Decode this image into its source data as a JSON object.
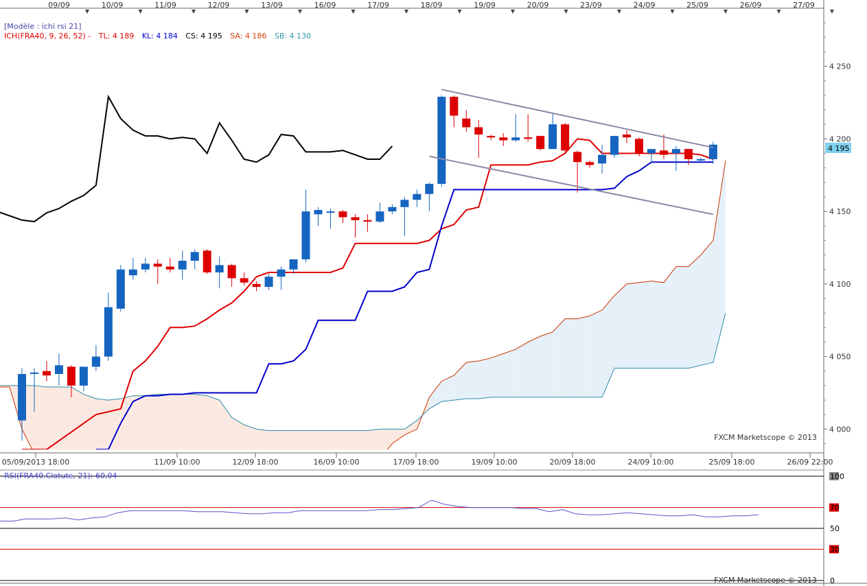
{
  "chart_data": {
    "type": "candlestick",
    "instrument": "FRA40",
    "model_label": "[Modèle : ichi rsi 21]",
    "top_dates": [
      "09/09",
      "10/09",
      "11/09",
      "12/09",
      "13/09",
      "16/09",
      "17/09",
      "18/09",
      "19/09",
      "20/09",
      "23/09",
      "24/09",
      "25/09",
      "26/09",
      "27/09"
    ],
    "bottom_dates": [
      "05/09/2013 18:00",
      "11/09 10:00",
      "12/09 18:00",
      "16/09 10:00",
      "17/09 18:00",
      "19/09 10:00",
      "20/09 18:00",
      "24/09 10:00",
      "25/09 18:00",
      "26/09 22:00"
    ],
    "price_ticks": [
      "4 250",
      "4 200",
      "4 150",
      "4 100",
      "4 050",
      "4 000"
    ],
    "price_ylim": [
      3986,
      4290
    ],
    "current_price_label": "4 195",
    "watermark": "FXCM Marketscope © 2013",
    "ichimoku": {
      "label": "ICH(FRA40, 9, 26, 52) -",
      "items": [
        {
          "text": "TL: 4 189",
          "color": "#e00000"
        },
        {
          "text": "KL: 4 184",
          "color": "#0000cc"
        },
        {
          "text": "CS: 4 195",
          "color": "#000000"
        },
        {
          "text": "SA: 4 186",
          "color": "#d04010"
        },
        {
          "text": "SB: 4 130",
          "color": "#3399aa"
        }
      ]
    },
    "candles": [
      {
        "o": 4006,
        "h": 4042,
        "l": 3992,
        "c": 4038
      },
      {
        "o": 4038,
        "h": 4042,
        "l": 4012,
        "c": 4039
      },
      {
        "o": 4040,
        "h": 4047,
        "l": 4033,
        "c": 4037
      },
      {
        "o": 4038,
        "h": 4052,
        "l": 4030,
        "c": 4044
      },
      {
        "o": 4043,
        "h": 4044,
        "l": 4022,
        "c": 4030
      },
      {
        "o": 4030,
        "h": 4043,
        "l": 4026,
        "c": 4043
      },
      {
        "o": 4043,
        "h": 4058,
        "l": 4040,
        "c": 4050
      },
      {
        "o": 4050,
        "h": 4094,
        "l": 4047,
        "c": 4084
      },
      {
        "o": 4083,
        "h": 4113,
        "l": 4081,
        "c": 4110
      },
      {
        "o": 4106,
        "h": 4118,
        "l": 4103,
        "c": 4110
      },
      {
        "o": 4110,
        "h": 4118,
        "l": 4108,
        "c": 4114
      },
      {
        "o": 4114,
        "h": 4117,
        "l": 4100,
        "c": 4112
      },
      {
        "o": 4112,
        "h": 4118,
        "l": 4108,
        "c": 4110
      },
      {
        "o": 4110,
        "h": 4123,
        "l": 4103,
        "c": 4116
      },
      {
        "o": 4116,
        "h": 4124,
        "l": 4110,
        "c": 4122
      },
      {
        "o": 4123,
        "h": 4124,
        "l": 4107,
        "c": 4108
      },
      {
        "o": 4108,
        "h": 4119,
        "l": 4097,
        "c": 4113
      },
      {
        "o": 4113,
        "h": 4114,
        "l": 4098,
        "c": 4104
      },
      {
        "o": 4104,
        "h": 4108,
        "l": 4099,
        "c": 4101
      },
      {
        "o": 4100,
        "h": 4102,
        "l": 4095,
        "c": 4098
      },
      {
        "o": 4098,
        "h": 4107,
        "l": 4096,
        "c": 4105
      },
      {
        "o": 4105,
        "h": 4112,
        "l": 4096,
        "c": 4110
      },
      {
        "o": 4110,
        "h": 4117,
        "l": 4107,
        "c": 4117
      },
      {
        "o": 4117,
        "h": 4165,
        "l": 4115,
        "c": 4150
      },
      {
        "o": 4148,
        "h": 4153,
        "l": 4140,
        "c": 4151
      },
      {
        "o": 4150,
        "h": 4152,
        "l": 4138,
        "c": 4150
      },
      {
        "o": 4150,
        "h": 4151,
        "l": 4142,
        "c": 4146
      },
      {
        "o": 4146,
        "h": 4148,
        "l": 4132,
        "c": 4144
      },
      {
        "o": 4144,
        "h": 4148,
        "l": 4136,
        "c": 4143
      },
      {
        "o": 4143,
        "h": 4156,
        "l": 4142,
        "c": 4150
      },
      {
        "o": 4150,
        "h": 4155,
        "l": 4148,
        "c": 4153
      },
      {
        "o": 4153,
        "h": 4160,
        "l": 4133,
        "c": 4158
      },
      {
        "o": 4158,
        "h": 4165,
        "l": 4153,
        "c": 4162
      },
      {
        "o": 4162,
        "h": 4170,
        "l": 4150,
        "c": 4169
      },
      {
        "o": 4169,
        "h": 4230,
        "l": 4167,
        "c": 4229
      },
      {
        "o": 4229,
        "h": 4230,
        "l": 4208,
        "c": 4216
      },
      {
        "o": 4214,
        "h": 4220,
        "l": 4205,
        "c": 4208
      },
      {
        "o": 4208,
        "h": 4213,
        "l": 4187,
        "c": 4203
      },
      {
        "o": 4202,
        "h": 4203,
        "l": 4199,
        "c": 4201
      },
      {
        "o": 4201,
        "h": 4204,
        "l": 4195,
        "c": 4199
      },
      {
        "o": 4199,
        "h": 4217,
        "l": 4198,
        "c": 4201
      },
      {
        "o": 4201,
        "h": 4217,
        "l": 4198,
        "c": 4200
      },
      {
        "o": 4202,
        "h": 4202,
        "l": 4192,
        "c": 4193
      },
      {
        "o": 4193,
        "h": 4218,
        "l": 4193,
        "c": 4210
      },
      {
        "o": 4210,
        "h": 4211,
        "l": 4190,
        "c": 4192
      },
      {
        "o": 4191,
        "h": 4192,
        "l": 4163,
        "c": 4184
      },
      {
        "o": 4184,
        "h": 4185,
        "l": 4180,
        "c": 4182
      },
      {
        "o": 4183,
        "h": 4196,
        "l": 4176,
        "c": 4189
      },
      {
        "o": 4189,
        "h": 4202,
        "l": 4187,
        "c": 4202
      },
      {
        "o": 4203,
        "h": 4206,
        "l": 4197,
        "c": 4201
      },
      {
        "o": 4200,
        "h": 4201,
        "l": 4188,
        "c": 4190
      },
      {
        "o": 4190,
        "h": 4193,
        "l": 4183,
        "c": 4193
      },
      {
        "o": 4192,
        "h": 4203,
        "l": 4186,
        "c": 4189
      },
      {
        "o": 4190,
        "h": 4195,
        "l": 4178,
        "c": 4193
      },
      {
        "o": 4193,
        "h": 4193,
        "l": 4182,
        "c": 4186
      },
      {
        "o": 4186,
        "h": 4187,
        "l": 4184,
        "c": 4186
      },
      {
        "o": 4186,
        "h": 4198,
        "l": 4183,
        "c": 4196
      }
    ],
    "chikou": [
      4150,
      4147,
      4144,
      4143,
      4149,
      4152,
      4157,
      4161,
      4168,
      4229,
      4214,
      4206,
      4202,
      4202,
      4200,
      4201,
      4200,
      4190,
      4211,
      4199,
      4186,
      4184,
      4189,
      4203,
      4202,
      4191,
      4191,
      4191,
      4192,
      4189,
      4186,
      4186,
      4195
    ],
    "tenkan_x": [
      0,
      2,
      6,
      7,
      8,
      9,
      10,
      11,
      12,
      13,
      14,
      15,
      16,
      17,
      18,
      19,
      20,
      21,
      22,
      23,
      24,
      25,
      26,
      27,
      28,
      29,
      30,
      31,
      32,
      33,
      34,
      35,
      36,
      37,
      38,
      39,
      40,
      41,
      42,
      43,
      44,
      45,
      46,
      47,
      48,
      49,
      50,
      51,
      52,
      53,
      54,
      55,
      56
    ],
    "tenkan": [
      3960,
      3985,
      4010,
      4012,
      4014,
      4040,
      4047,
      4057,
      4070,
      4070,
      4071,
      4076,
      4082,
      4087,
      4095,
      4105,
      4108,
      4108,
      4108,
      4108,
      4108,
      4108,
      4111,
      4128,
      4128,
      4128,
      4128,
      4128,
      4128,
      4130,
      4138,
      4141,
      4151,
      4153,
      4182,
      4182,
      4182,
      4182,
      4184,
      4185,
      4190,
      4200,
      4199,
      4190,
      4190,
      4190,
      4190,
      4190,
      4190,
      4190,
      4190,
      4189,
      4186,
      4185,
      4188,
      4190,
      4189
    ],
    "kijun_x": [
      6,
      7,
      8,
      9,
      10,
      11,
      12,
      13,
      14,
      15,
      16,
      17,
      18,
      19,
      20,
      21,
      22,
      23,
      24,
      25,
      26,
      27,
      28,
      29,
      30,
      31,
      32,
      33,
      34,
      35,
      36,
      37,
      38,
      39,
      40,
      41,
      42,
      43,
      44,
      45,
      46,
      47,
      48,
      49,
      50,
      51,
      52,
      53,
      54,
      55,
      56
    ],
    "kijun": [
      3966,
      3985,
      4004,
      4019,
      4023,
      4023,
      4024,
      4024,
      4025,
      4025,
      4025,
      4025,
      4025,
      4025,
      4045,
      4045,
      4047,
      4055,
      4075,
      4075,
      4075,
      4075,
      4095,
      4095,
      4095,
      4098,
      4108,
      4110,
      4140,
      4165,
      4165,
      4165,
      4165,
      4165,
      4165,
      4165,
      4165,
      4165,
      4165,
      4165,
      4165,
      4165,
      4166,
      4174,
      4178,
      4184,
      4184,
      4184,
      4184,
      4184,
      4184
    ],
    "senkou_a_x": [
      0,
      1,
      2,
      3,
      4,
      5,
      6,
      7,
      8,
      9,
      10,
      11,
      12,
      13,
      14,
      15,
      16,
      17,
      18,
      19,
      20,
      21,
      22,
      23,
      24,
      25,
      26,
      27,
      28,
      29,
      30,
      31,
      32,
      33,
      34,
      35,
      36,
      37,
      38,
      39,
      40,
      41,
      42,
      43,
      44,
      45,
      46,
      47,
      48,
      49,
      50,
      51,
      52,
      53,
      54,
      55,
      56,
      57
    ],
    "senkou_a": [
      4029,
      4029,
      4000,
      3983,
      3980,
      3980,
      3980,
      3980,
      3980,
      3980,
      3980,
      3980,
      3980,
      3980,
      3980,
      3980,
      3980,
      3980,
      3980,
      3980,
      3980,
      3980,
      3980,
      3980,
      3980,
      3980,
      3980,
      3980,
      3980,
      3980,
      3980,
      3980,
      3990,
      3996,
      4000,
      4022,
      4033,
      4037,
      4046,
      4047,
      4049,
      4052,
      4055,
      4060,
      4064,
      4067,
      4076,
      4076,
      4078,
      4082,
      4092,
      4100,
      4101,
      4102,
      4101,
      4112,
      4112,
      4120,
      4130,
      4185
    ],
    "senkou_b": [
      4030,
      4030,
      4030,
      4030,
      4029,
      4029,
      4029,
      4024,
      4021,
      4020,
      4021,
      4023,
      4023,
      4024,
      4024,
      4024,
      4024,
      4023,
      4020,
      4008,
      4003,
      4000,
      3999,
      3999,
      3999,
      3999,
      3999,
      3999,
      3999,
      3999,
      3999,
      4000,
      4000,
      4000,
      4006,
      4014,
      4019,
      4020,
      4021,
      4021,
      4022,
      4022,
      4022,
      4022,
      4022,
      4022,
      4022,
      4022,
      4022,
      4022,
      4042,
      4042,
      4042,
      4042,
      4042,
      4042,
      4042,
      4044,
      4046,
      4080
    ],
    "trendlines": [
      {
        "x1": 34,
        "y1": 4234,
        "x2": 56,
        "y2": 4194
      },
      {
        "x1": 33,
        "y1": 4188,
        "x2": 56,
        "y2": 4148
      }
    ],
    "rsi": {
      "label": "RSI(FRA40.Clotute, 21): 60,04",
      "levels": [
        "100",
        "70",
        "50",
        "30",
        "0"
      ],
      "ylim": [
        0,
        100
      ],
      "values": [
        57,
        57,
        59,
        59,
        59,
        60,
        58,
        60,
        61,
        65,
        67,
        67,
        67,
        67,
        67,
        66,
        66,
        66,
        65,
        64,
        64,
        65,
        65,
        67,
        67,
        67,
        67,
        67,
        67,
        68,
        68,
        69,
        70,
        77,
        73,
        71,
        70,
        70,
        70,
        70,
        69,
        69,
        66,
        68,
        64,
        63,
        63,
        64,
        65,
        64,
        63,
        62,
        62,
        63,
        61,
        61,
        62,
        62,
        63
      ]
    },
    "colors": {
      "bull": "#1565c0",
      "bear": "#dd0000",
      "tenkan": "#e00000",
      "kijun": "#0000cc",
      "chikou": "#000000",
      "senkou_a": "#cc3300",
      "senkou_b": "#2a8aa8",
      "cloud_bull": "#e6f0f8",
      "cloud_bear": "#fbe9e1",
      "trendline": "#8a8aa8",
      "rsi_line": "#5555cc"
    }
  }
}
